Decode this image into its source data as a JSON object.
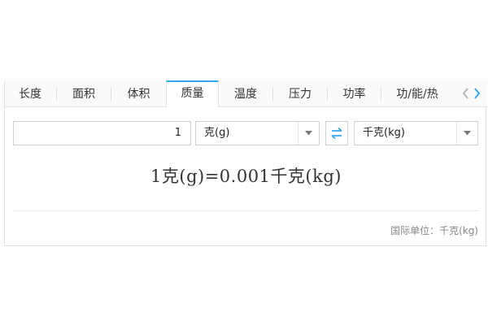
{
  "tabs": [
    {
      "label": "长度",
      "active": false
    },
    {
      "label": "面积",
      "active": false
    },
    {
      "label": "体积",
      "active": false
    },
    {
      "label": "质量",
      "active": true
    },
    {
      "label": "温度",
      "active": false
    },
    {
      "label": "压力",
      "active": false
    },
    {
      "label": "功率",
      "active": false
    },
    {
      "label": "功/能/热",
      "active": false
    }
  ],
  "nav": {
    "prev_icon": "chevron-left-icon",
    "next_icon": "chevron-right-icon"
  },
  "input": {
    "value": "1"
  },
  "from_unit": {
    "selected": "克(g)"
  },
  "to_unit": {
    "selected": "千克(kg)"
  },
  "swap": {
    "icon": "swap-arrows-icon"
  },
  "result": {
    "text": "1克(g)=0.001千克(kg)"
  },
  "footer": {
    "si_unit_text": "国际单位：千克(kg)"
  },
  "colors": {
    "accent": "#38a4f0",
    "border": "#cfcfcf",
    "text": "#333333",
    "muted": "#888888"
  }
}
